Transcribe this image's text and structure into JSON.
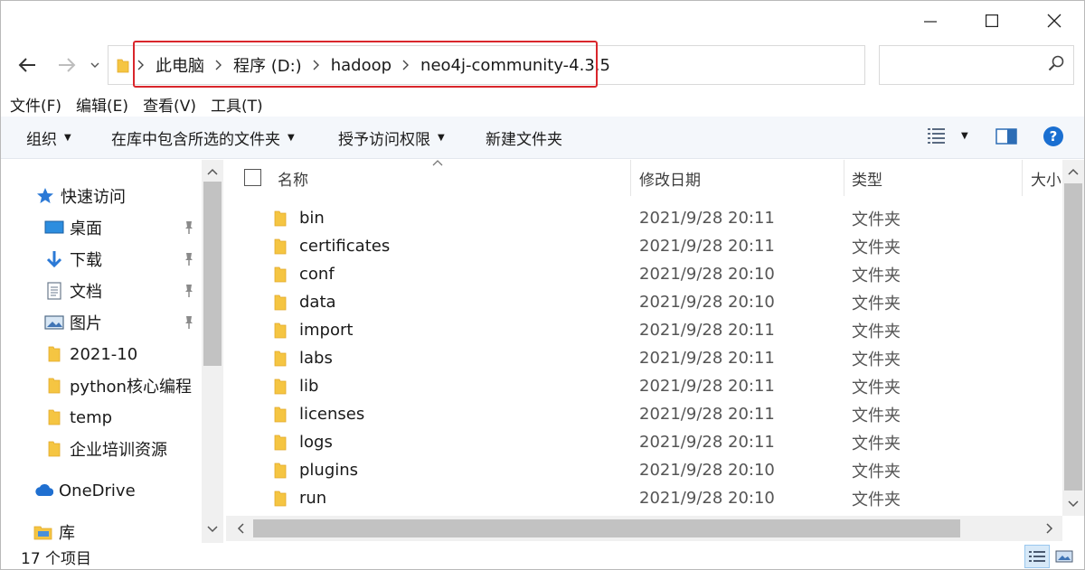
{
  "window": {
    "controls": {
      "minimize": "minimize",
      "maximize": "maximize",
      "close": "close"
    }
  },
  "address": {
    "breadcrumbs": [
      "此电脑",
      "程序 (D:)",
      "hadoop",
      "neo4j-community-4.3.5"
    ],
    "search_placeholder": ""
  },
  "menu": [
    "文件(F)",
    "编辑(E)",
    "查看(V)",
    "工具(T)"
  ],
  "commands": {
    "organize": "组织",
    "include_library": "在库中包含所选的文件夹",
    "grant_access": "授予访问权限",
    "new_folder": "新建文件夹",
    "help": "?"
  },
  "navpane": {
    "quick_access": "快速访问",
    "items": [
      {
        "label": "桌面",
        "icon": "desktop-icon",
        "pinned": true
      },
      {
        "label": "下载",
        "icon": "download-icon",
        "pinned": true
      },
      {
        "label": "文档",
        "icon": "document-icon",
        "pinned": true
      },
      {
        "label": "图片",
        "icon": "picture-icon",
        "pinned": true
      },
      {
        "label": "2021-10",
        "icon": "folder-icon",
        "pinned": false
      },
      {
        "label": "python核心编程",
        "icon": "folder-icon",
        "pinned": false
      },
      {
        "label": "temp",
        "icon": "folder-icon",
        "pinned": false
      },
      {
        "label": "企业培训资源",
        "icon": "folder-icon",
        "pinned": false
      }
    ],
    "onedrive": "OneDrive",
    "library": "库"
  },
  "columns": {
    "name": "名称",
    "modified": "修改日期",
    "type": "类型",
    "size": "大小"
  },
  "files": [
    {
      "name": "bin",
      "modified": "2021/9/28 20:11",
      "type": "文件夹"
    },
    {
      "name": "certificates",
      "modified": "2021/9/28 20:11",
      "type": "文件夹"
    },
    {
      "name": "conf",
      "modified": "2021/9/28 20:10",
      "type": "文件夹"
    },
    {
      "name": "data",
      "modified": "2021/9/28 20:10",
      "type": "文件夹"
    },
    {
      "name": "import",
      "modified": "2021/9/28 20:11",
      "type": "文件夹"
    },
    {
      "name": "labs",
      "modified": "2021/9/28 20:11",
      "type": "文件夹"
    },
    {
      "name": "lib",
      "modified": "2021/9/28 20:11",
      "type": "文件夹"
    },
    {
      "name": "licenses",
      "modified": "2021/9/28 20:11",
      "type": "文件夹"
    },
    {
      "name": "logs",
      "modified": "2021/9/28 20:11",
      "type": "文件夹"
    },
    {
      "name": "plugins",
      "modified": "2021/9/28 20:10",
      "type": "文件夹"
    },
    {
      "name": "run",
      "modified": "2021/9/28 20:10",
      "type": "文件夹"
    }
  ],
  "status": {
    "item_count": "17 个项目"
  },
  "colors": {
    "folder": "#f5c542",
    "folder_dark": "#e1a92a",
    "highlight": "#d9262c",
    "command_bar": "#f4f7fb",
    "help_blue": "#1a6fd1"
  }
}
